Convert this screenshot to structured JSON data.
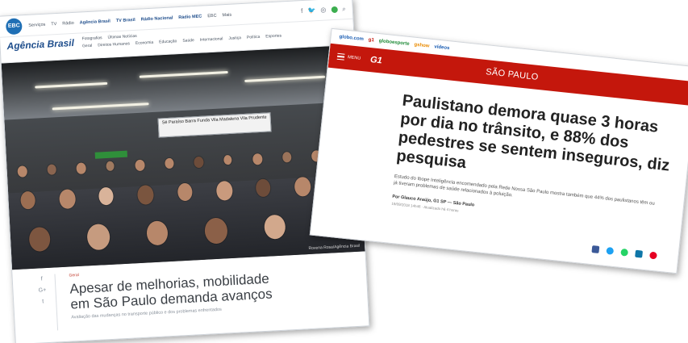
{
  "left_page": {
    "topbar": {
      "logo": "EBC",
      "links": [
        "Serviços",
        "TV",
        "Rádio",
        "Agência Brasil",
        "TV Brasil",
        "Rádio Nacional",
        "Rádio MEC",
        "EBC",
        "Mais"
      ],
      "search_icon": "search-icon"
    },
    "brand": "Agência Brasil",
    "nav_rows": [
      [
        "Fotografias",
        "Últimas Notícias"
      ],
      [
        "Geral",
        "Direitos Humanos",
        "Economia",
        "Educação",
        "Saúde",
        "Internacional",
        "Justiça",
        "Política",
        "Esportes"
      ]
    ],
    "photo": {
      "sign_lines": [
        "Sé",
        "Paraíso",
        "Barra Funda",
        "Vila Madalena",
        "Vila Prudente"
      ],
      "credit": "Rovena Rosa/Agência Brasil"
    },
    "article": {
      "kicker": "Geral",
      "title": "Apesar de melhorias, mobilidade em São Paulo demanda avanços",
      "subtitle": "Avaliação das mudanças no transporte público e dos problemas enfrentados",
      "social": [
        "f",
        "G+",
        "t"
      ]
    }
  },
  "right_page": {
    "globo_links": [
      "globo.com",
      "g1",
      "globoesporte",
      "gshow",
      "vídeos"
    ],
    "menu_label": "MENU",
    "logo": "G1",
    "section": "SÃO PAULO",
    "headline": "Paulistano demora quase 3 horas por dia no trânsito, e 88% dos pedestres se sentem inseguros, diz pesquisa",
    "subtitle": "Estudo do Ibope Inteligência encomendado pela Rede Nossa São Paulo mostra também que 44% dos paulistanos têm ou já tiveram problemas de saúde relacionados à poluição.",
    "byline": "Por Glauco Araújo, G1 SP — São Paulo",
    "date": "19/09/2018 14h46 · Atualizado há 4 horas",
    "share_icons": [
      "facebook-icon",
      "twitter-icon",
      "whatsapp-icon",
      "linkedin-icon",
      "pinterest-icon"
    ],
    "colors": {
      "brand_red": "#c4170c"
    }
  }
}
